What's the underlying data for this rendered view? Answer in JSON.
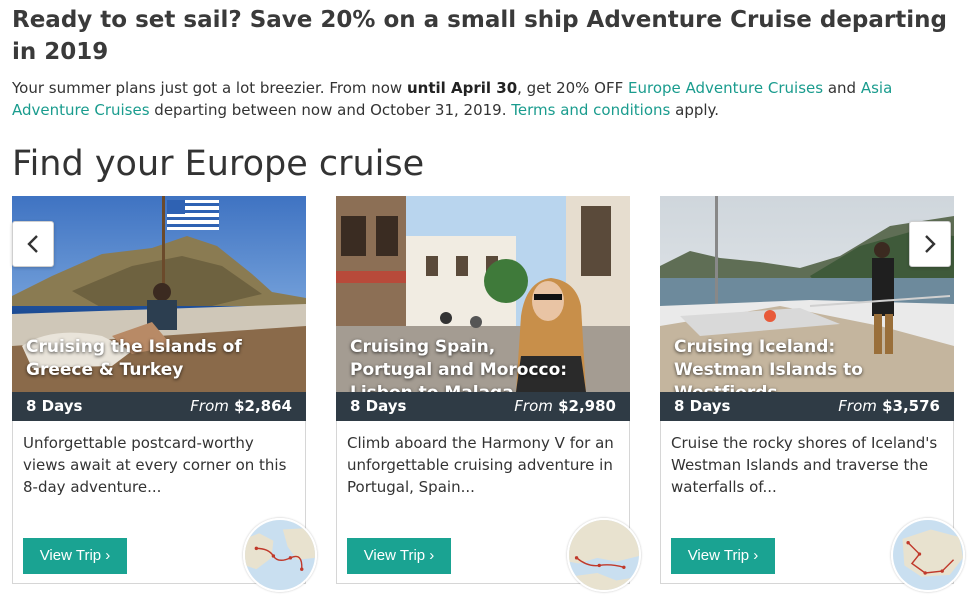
{
  "promo": {
    "title": "Ready to set sail? Save 20% on a small ship Adventure Cruise departing in 2019",
    "text_1": "Your summer plans just got a lot breezier. From now ",
    "text_bold": "until April 30",
    "text_2": ", get 20% OFF ",
    "link_europe": "Europe Adventure Cruises",
    "text_3": " and ",
    "link_asia": "Asia Adventure Cruises",
    "text_4": " departing between now and October 31, 2019. ",
    "link_terms": "Terms and conditions",
    "text_5": " apply."
  },
  "section": {
    "title": "Find your Europe cruise"
  },
  "cards": [
    {
      "title": "Cruising the Islands of Greece & Turkey",
      "days": "8 Days",
      "from": "From",
      "price": "$2,864",
      "description": "Unforgettable postcard-worthy views await at every corner on this 8-day adventure...",
      "button": "View Trip ›"
    },
    {
      "title": "Cruising Spain, Portugal and Morocco: Lisbon to Malaga",
      "days": "8 Days",
      "from": "From",
      "price": "$2,980",
      "description": "Climb aboard the Harmony V for an unforgettable cruising adventure in Portugal, Spain...",
      "button": "View Trip ›"
    },
    {
      "title": "Cruising Iceland: Westman Islands to Westfjords",
      "days": "8 Days",
      "from": "From",
      "price": "$3,576",
      "description": "Cruise the rocky shores of Iceland's Westman Islands and traverse the waterfalls of...",
      "button": "View Trip ›"
    }
  ],
  "carousel": {
    "prev_icon": "chevron-left-icon",
    "next_icon": "chevron-right-icon"
  },
  "colors": {
    "link": "#1a9c8e",
    "button": "#1aa392",
    "price_bar": "#2f3b45"
  }
}
